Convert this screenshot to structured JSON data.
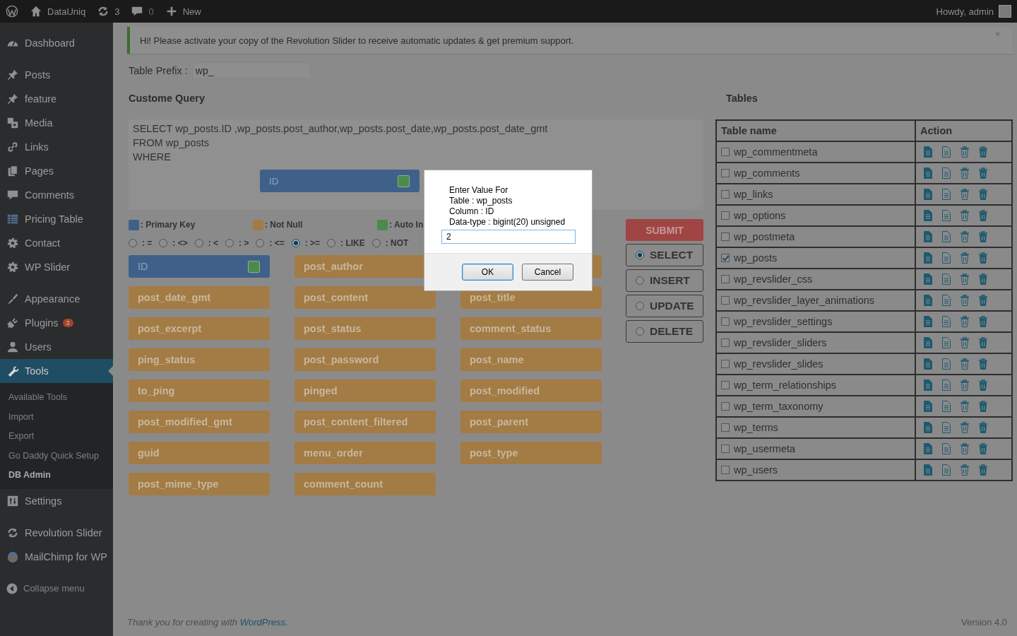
{
  "admin_bar": {
    "site_name": "DataUniq",
    "updates": "3",
    "comments": "0",
    "new_label": "New",
    "greeting": "Howdy, admin"
  },
  "sidebar": {
    "groups": [
      [
        {
          "label": "Dashboard",
          "selected": false
        }
      ],
      [
        {
          "label": "Posts",
          "selected": false
        },
        {
          "label": "feature",
          "selected": false
        },
        {
          "label": "Media",
          "selected": false
        },
        {
          "label": "Links",
          "selected": false
        },
        {
          "label": "Pages",
          "selected": false
        },
        {
          "label": "Comments",
          "selected": false
        },
        {
          "label": "Pricing Table",
          "selected": false
        },
        {
          "label": "Contact",
          "selected": false
        },
        {
          "label": "WP Slider",
          "selected": false
        }
      ],
      [
        {
          "label": "Appearance",
          "selected": false
        },
        {
          "label": "Plugins",
          "selected": false,
          "badge": "3"
        },
        {
          "label": "Users",
          "selected": false
        },
        {
          "label": "Tools",
          "selected": true,
          "children": [
            {
              "label": "Available Tools",
              "selected": false
            },
            {
              "label": "Import",
              "selected": false
            },
            {
              "label": "Export",
              "selected": false
            },
            {
              "label": "Go Daddy Quick Setup",
              "selected": false
            },
            {
              "label": "DB Admin",
              "selected": true
            }
          ]
        },
        {
          "label": "Settings",
          "selected": false
        }
      ],
      [
        {
          "label": "Revolution Slider",
          "selected": false
        },
        {
          "label": "MailChimp for WP",
          "selected": false
        }
      ]
    ],
    "collapse_label": "Collapse menu"
  },
  "notice": {
    "text": "Hi! Please activate your copy of the Revolution Slider to receive automatic updates & get premium support.",
    "dismiss": "×"
  },
  "prefix": {
    "label": "Table Prefix :",
    "value": "wp_"
  },
  "query": {
    "heading": "Custome Query",
    "lines": [
      "SELECT wp_posts.ID ,wp_posts.post_author,wp_posts.post_date,wp_posts.post_date_gmt",
      "FROM wp_posts",
      "WHERE"
    ],
    "chips": [
      {
        "label": "ID",
        "kind": "primary",
        "auto_increment": true
      }
    ]
  },
  "legend": [
    {
      "label": ": Primary Key",
      "color": "#3f6189"
    },
    {
      "label": ": Not Null",
      "color": "#a37b45"
    },
    {
      "label": ": Auto In",
      "color": "#4b8a4b"
    }
  ],
  "operators": [
    {
      "label": ": =",
      "selected": false
    },
    {
      "label": ": <>",
      "selected": false
    },
    {
      "label": ": <",
      "selected": false
    },
    {
      "label": ": >",
      "selected": false
    },
    {
      "label": ": <=",
      "selected": false
    },
    {
      "label": ": >=",
      "selected": true
    },
    {
      "label": ": LIKE",
      "selected": false
    },
    {
      "label": ": NOT",
      "selected": false
    }
  ],
  "fields": [
    {
      "label": "ID",
      "kind": "primary",
      "auto_increment": true
    },
    {
      "label": "post_author",
      "kind": "not_null"
    },
    {
      "kind": "not_null"
    },
    {
      "label": "post_date_gmt",
      "kind": "not_null"
    },
    {
      "label": "post_content",
      "kind": "not_null"
    },
    {
      "label": "post_title",
      "kind": "not_null"
    },
    {
      "label": "post_excerpt",
      "kind": "not_null"
    },
    {
      "label": "post_status",
      "kind": "not_null"
    },
    {
      "label": "comment_status",
      "kind": "not_null"
    },
    {
      "label": "ping_status",
      "kind": "not_null"
    },
    {
      "label": "post_password",
      "kind": "not_null"
    },
    {
      "label": "post_name",
      "kind": "not_null"
    },
    {
      "label": "to_ping",
      "kind": "not_null"
    },
    {
      "label": "pinged",
      "kind": "not_null"
    },
    {
      "label": "post_modified",
      "kind": "not_null"
    },
    {
      "label": "post_modified_gmt",
      "kind": "not_null"
    },
    {
      "label": "post_content_filtered",
      "kind": "not_null"
    },
    {
      "label": "post_parent",
      "kind": "not_null"
    },
    {
      "label": "guid",
      "kind": "not_null"
    },
    {
      "label": "menu_order",
      "kind": "not_null"
    },
    {
      "label": "post_type",
      "kind": "not_null"
    },
    {
      "label": "post_mime_type",
      "kind": "not_null"
    },
    {
      "label": "comment_count",
      "kind": "not_null"
    }
  ],
  "actions": {
    "submit": "SUBMIT",
    "modes": [
      {
        "label": "SELECT",
        "selected": true
      },
      {
        "label": "INSERT",
        "selected": false
      },
      {
        "label": "UPDATE",
        "selected": false
      },
      {
        "label": "DELETE",
        "selected": false
      }
    ]
  },
  "tables": {
    "heading": "Tables",
    "columns": [
      "Table name",
      "Action"
    ],
    "rows": [
      {
        "name": "wp_commentmeta",
        "checked": false
      },
      {
        "name": "wp_comments",
        "checked": false
      },
      {
        "name": "wp_links",
        "checked": false
      },
      {
        "name": "wp_options",
        "checked": false
      },
      {
        "name": "wp_postmeta",
        "checked": false
      },
      {
        "name": "wp_posts",
        "checked": true
      },
      {
        "name": "wp_revslider_css",
        "checked": false
      },
      {
        "name": "wp_revslider_layer_animations",
        "checked": false
      },
      {
        "name": "wp_revslider_settings",
        "checked": false
      },
      {
        "name": "wp_revslider_sliders",
        "checked": false
      },
      {
        "name": "wp_revslider_slides",
        "checked": false
      },
      {
        "name": "wp_term_relationships",
        "checked": false
      },
      {
        "name": "wp_term_taxonomy",
        "checked": false
      },
      {
        "name": "wp_terms",
        "checked": false
      },
      {
        "name": "wp_usermeta",
        "checked": false
      },
      {
        "name": "wp_users",
        "checked": false
      }
    ]
  },
  "dialog": {
    "lines": [
      "Enter Value For",
      "Table : wp_posts",
      "Column : ID",
      "Data-type : bigint(20) unsigned"
    ],
    "value": "2",
    "buttons": [
      {
        "label": "OK",
        "focused": true
      },
      {
        "label": "Cancel",
        "focused": false
      }
    ]
  },
  "footer": {
    "text": "Thank you for creating with ",
    "link": "WordPress",
    "after": ".",
    "version": "Version 4.0"
  }
}
